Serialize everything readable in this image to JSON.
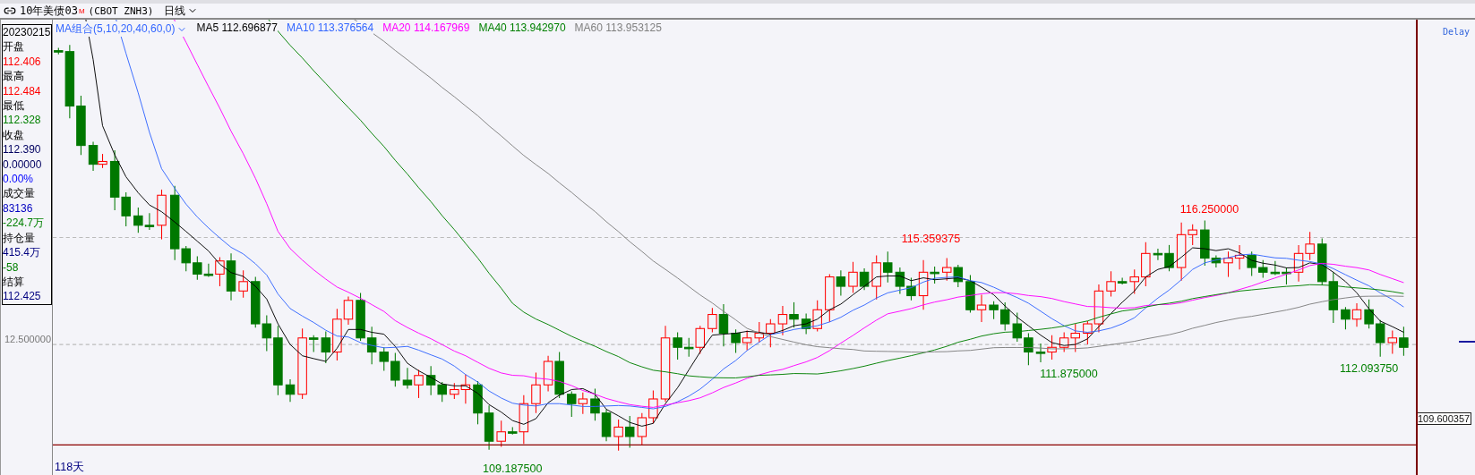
{
  "header": {
    "title": "10年美债03",
    "badge": "M",
    "code": "(CBOT ZNH3)",
    "period": "日线"
  },
  "info_panel": [
    {
      "text": "20230215",
      "kind": "label"
    },
    {
      "text": "开盘",
      "kind": "label"
    },
    {
      "text": "112.406",
      "kind": "value",
      "color": "#ff0000"
    },
    {
      "text": "最高",
      "kind": "label"
    },
    {
      "text": "112.484",
      "kind": "value",
      "color": "#ff0000"
    },
    {
      "text": "最低",
      "kind": "label"
    },
    {
      "text": "112.328",
      "kind": "value",
      "color": "#008000"
    },
    {
      "text": "收盘",
      "kind": "label"
    },
    {
      "text": "112.390",
      "kind": "value",
      "color": "#000060"
    },
    {
      "text": "0.00000",
      "kind": "value",
      "color": "#000060"
    },
    {
      "text": "0.00%",
      "kind": "value",
      "color": "#0000ff"
    },
    {
      "text": "成交量",
      "kind": "label"
    },
    {
      "text": "83136",
      "kind": "value",
      "color": "#0000c0"
    },
    {
      "text": "-224.7万",
      "kind": "value",
      "color": "#008000"
    },
    {
      "text": "持仓量",
      "kind": "label"
    },
    {
      "text": "415.4万",
      "kind": "value",
      "color": "#000080"
    },
    {
      "text": "-58",
      "kind": "value",
      "color": "#008000"
    },
    {
      "text": "结算",
      "kind": "label"
    },
    {
      "text": "112.425",
      "kind": "value",
      "color": "#000080"
    }
  ],
  "legend": {
    "label": "MA组合(5,10,20,40,60,0)",
    "items": [
      {
        "name": "MA5",
        "value": "112.696877",
        "color": "#000000"
      },
      {
        "name": "MA10",
        "value": "113.376564",
        "color": "#3366ff"
      },
      {
        "name": "MA20",
        "value": "114.167969",
        "color": "#ff00ff"
      },
      {
        "name": "MA40",
        "value": "113.942970",
        "color": "#008000"
      },
      {
        "name": "MA60",
        "value": "113.953125",
        "color": "#808080"
      }
    ]
  },
  "axis_label": "12.500000",
  "price_labels": [
    {
      "text": "116.250000",
      "kind": "high"
    },
    {
      "text": "115.359375",
      "kind": "high"
    },
    {
      "text": "111.875000",
      "kind": "low"
    },
    {
      "text": "112.093750",
      "kind": "low"
    },
    {
      "text": "109.187500",
      "kind": "low"
    }
  ],
  "day_count": "118天",
  "status": "Delay",
  "cursor_value": "109.600357"
}
